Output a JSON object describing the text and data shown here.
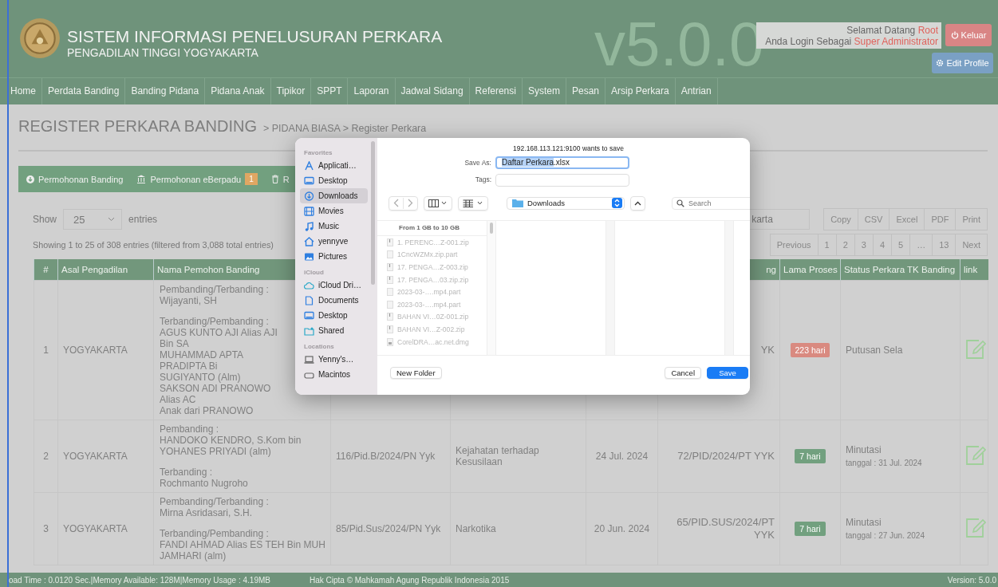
{
  "header": {
    "title": "SISTEM INFORMASI PENELUSURAN PERKARA",
    "subtitle": "PENGADILAN TINGGI YOGYAKARTA",
    "version_mark": "v5.0.0",
    "greeting": "Selamat Datang",
    "user": "Root",
    "role_label": "Anda Login Sebagai",
    "role": "Super Administrator",
    "logout": "Keluar",
    "edit_profile": "Edit Profile"
  },
  "nav": [
    "Home",
    "Perdata Banding",
    "Banding Pidana",
    "Pidana Anak",
    "Tipikor",
    "SPPT",
    "Laporan",
    "Jadwal Sidang",
    "Referensi",
    "System",
    "Pesan",
    "Arsip Perkara",
    "Antrian"
  ],
  "page": {
    "title": "REGISTER PERKARA BANDING",
    "breadcrumb": "> PIDANA BIASA > Register Perkara"
  },
  "actions": [
    {
      "label": "Permohonan Banding",
      "kind": "download"
    },
    {
      "label": "Permohonan eBerpadu",
      "kind": "bank",
      "badge": "1"
    },
    {
      "label": "R",
      "kind": "trash"
    }
  ],
  "table_controls": {
    "show_label": "Show",
    "page_size": "25",
    "entries_label": "entries",
    "info": "Showing 1 to 25 of 308 entries (filtered from 3,088 total entries)",
    "search_value": "karta",
    "export_buttons": [
      "Copy",
      "CSV",
      "Excel",
      "PDF",
      "Print"
    ],
    "pagination": [
      "Previous",
      "1",
      "2",
      "3",
      "4",
      "5",
      "…",
      "13",
      "Next"
    ]
  },
  "table": {
    "columns": [
      "#",
      "Asal Pengadilan",
      "Nama Pemohon Banding",
      "",
      "",
      "",
      "ng",
      "Lama Proses",
      "Status Perkara TK Banding",
      "link"
    ],
    "rows": [
      {
        "number": "1",
        "asal_pengadilan": "YOGYAKARTA",
        "nama_pemohon_banding": [
          {
            "role": "Pembanding/Terbanding :",
            "names": [
              "Wijayanti, SH"
            ]
          },
          {
            "role": "Terbanding/Pembanding :",
            "names": [
              "AGUS KUNTO AJI Alias AJI Bin SA",
              "MUHAMMAD APTA PRADIPTA Bi",
              "SUGIYANTO (Alm)",
              "SAKSON ADI PRANOWO Alias AC",
              "Anak dari PRANOWO"
            ]
          }
        ],
        "column_7": "YK",
        "lama_proses": {
          "text": "223 hari",
          "color": "#d98a80"
        },
        "status": {
          "text": "Putusan Sela"
        }
      },
      {
        "number": "2",
        "asal_pengadilan": "YOGYAKARTA",
        "nama_pemohon_banding": [
          {
            "role": "Pembanding :",
            "names": [
              "HANDOKO KENDRO, S.Kom bin",
              "YOHANES PRIYADI (alm)"
            ]
          },
          {
            "role": "Terbanding :",
            "names": [
              "Rochmanto Nugroho"
            ]
          }
        ],
        "column_4": "116/Pid.B/2024/PN Yyk",
        "column_5": "Kejahatan terhadap Kesusilaan",
        "column_6": "24 Jul. 2024",
        "column_7": "72/PID/2024/PT YYK",
        "lama_proses": {
          "text": "7 hari",
          "color": "#72a07f"
        },
        "status": {
          "text": "Minutasi",
          "date": "tanggal : 31 Jul. 2024"
        }
      },
      {
        "number": "3",
        "asal_pengadilan": "YOGYAKARTA",
        "nama_pemohon_banding": [
          {
            "role": "Pembanding/Terbanding :",
            "names": [
              "Mirna Asridasari, S.H."
            ]
          },
          {
            "role": "Terbanding/Pembanding :",
            "names": [
              "FANDI AHMAD Alias ES TEH Bin MUH",
              "JAMHARI (alm)"
            ]
          }
        ],
        "column_4": "85/Pid.Sus/2024/PN Yyk",
        "column_5": "Narkotika",
        "column_6": "20 Jun. 2024",
        "column_7": "65/PID.SUS/2024/PT YYK",
        "lama_proses": {
          "text": "7 hari",
          "color": "#72a07f"
        },
        "status": {
          "text": "Minutasi",
          "date": "tanggal : 27 Jun. 2024"
        }
      }
    ]
  },
  "save_dialog": {
    "message": "192.168.113.121:9100 wants to save",
    "save_as_label": "Save As:",
    "filename": [
      {
        "text": "Daftar Perkara",
        "selected": true
      },
      {
        "text": ".xlsx",
        "selected": false
      }
    ],
    "tags_label": "Tags:",
    "location": "Downloads",
    "search_placeholder": "Search",
    "sidebar": [
      {
        "heading": "Favorites",
        "items": [
          {
            "label": "Applicati…",
            "kind": "apps",
            "selected": false
          },
          {
            "label": "Desktop",
            "kind": "desktop",
            "selected": false
          },
          {
            "label": "Downloads",
            "kind": "downloads",
            "selected": true
          },
          {
            "label": "Movies",
            "kind": "movies",
            "selected": false
          },
          {
            "label": "Music",
            "kind": "music",
            "selected": false
          },
          {
            "label": "yennyve",
            "kind": "home",
            "selected": false
          },
          {
            "label": "Pictures",
            "kind": "pictures",
            "selected": false
          }
        ]
      },
      {
        "heading": "iCloud",
        "items": [
          {
            "label": "iCloud Dri…",
            "kind": "cloud",
            "selected": false
          },
          {
            "label": "Documents",
            "kind": "document",
            "selected": false
          },
          {
            "label": "Desktop",
            "kind": "desktop",
            "selected": false
          },
          {
            "label": "Shared",
            "kind": "shared",
            "selected": false
          }
        ]
      },
      {
        "heading": "Locations",
        "items": [
          {
            "label": "Yenny's…",
            "kind": "laptop",
            "selected": false
          },
          {
            "label": "Macintos",
            "kind": "disk",
            "selected": false
          }
        ]
      }
    ],
    "files_header": "From 1 GB to 10 GB",
    "files": [
      {
        "name": "1. PERENC…Z-001.zip",
        "kind": "zip",
        "disabled": true
      },
      {
        "name": "1CncWZMx.zip.part",
        "kind": "file",
        "disabled": true
      },
      {
        "name": "17. PENGA…Z-003.zip",
        "kind": "zip",
        "disabled": true
      },
      {
        "name": "17. PENGA…03.zip.zip",
        "kind": "zip",
        "disabled": true
      },
      {
        "name": "2023-03-….mp4.part",
        "kind": "file",
        "disabled": true
      },
      {
        "name": "2023-03-….mp4.part",
        "kind": "file",
        "disabled": true
      },
      {
        "name": "BAHAN VI…0Z-001.zip",
        "kind": "zip",
        "disabled": true
      },
      {
        "name": "BAHAN VI…Z-002.zip",
        "kind": "zip",
        "disabled": true
      },
      {
        "name": "CorelDRA…ac.net.dmg",
        "kind": "disk",
        "disabled": true
      }
    ],
    "buttons": [
      {
        "label": "New Folder",
        "kind": "secondary"
      },
      {
        "label": "Cancel",
        "kind": "secondary"
      },
      {
        "label": "Save",
        "kind": "default"
      }
    ]
  },
  "footer": {
    "stats": "oad Time : 0.0120 Sec.|Memory Available: 128M|Memory Usage : 4.19MB",
    "copyright": "Hak Cipta © Mahkamah Agung Republik Indonesia 2015",
    "version": "Version: 5.0.0"
  }
}
